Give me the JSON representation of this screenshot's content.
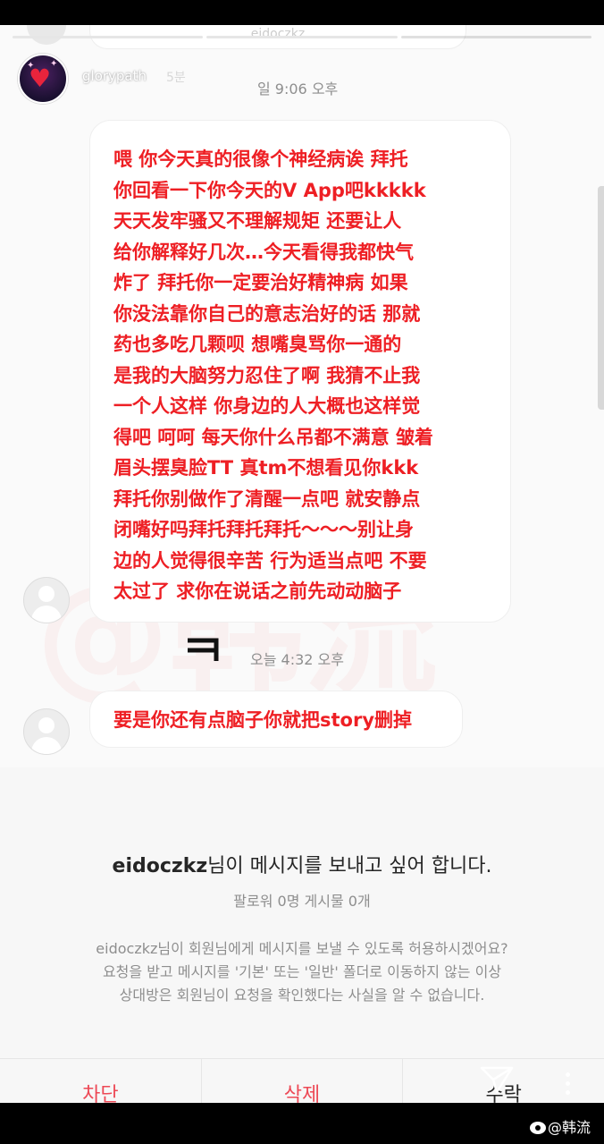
{
  "story": {
    "username": "glorypath",
    "posted_ago": "5분",
    "ghost_username": "eidoczkz"
  },
  "chat": {
    "timestamp_1": "일 9:06 오후",
    "message_1": "喂 你今天真的很像个神经病诶 拜托\n你回看一下你今天的V App吧kkkkk\n天天发牢骚又不理解规矩 还要让人\n给你解释好几次…今天看得我都快气\n炸了 拜托你一定要治好精神病 如果\n你没法靠你自己的意志治好的话 那就\n药也多吃几颗呗 想嘴臭骂你一通的\n是我的大脑努力忍住了啊 我猜不止我\n一个人这样 你身边的人大概也这样觉\n得吧 呵呵 每天你什么吊都不满意 皱着\n眉头摆臭脸TT 真tm不想看见你kkk\n拜托你别做作了清醒一点吧 就安静点\n闭嘴好吗拜托拜托拜托～～～别让身\n边的人觉得很辛苦 行为适当点吧 不要\n太过了 求你在说话之前先动动脑子",
    "reaction_icon": "korean-k-glyph",
    "timestamp_2": "오늘 4:32 오후",
    "message_2": "要是你还有点脑子你就把story删掉",
    "message_color": "#ee1f24"
  },
  "request": {
    "requester": "eidoczkz",
    "title_suffix": "님이 메시지를 보내고 싶어 합니다.",
    "stats": "팔로워 0명 게시물 0개",
    "info_line_1": "eidoczkz님이 회원님에게 메시지를 보낼 수 있도록 허용하시겠어요?",
    "info_line_2": "요청을 받고 메시지를 '기본' 또는 '일반' 폴더로 이동하지 않는 이상",
    "info_line_3": "상대방은 회원님이 요청을 확인했다는 사실을 알 수 없습니다.",
    "buttons": [
      "차단",
      "삭제",
      "수락"
    ]
  },
  "watermark": {
    "text": "@韩流",
    "source": "韩流"
  }
}
